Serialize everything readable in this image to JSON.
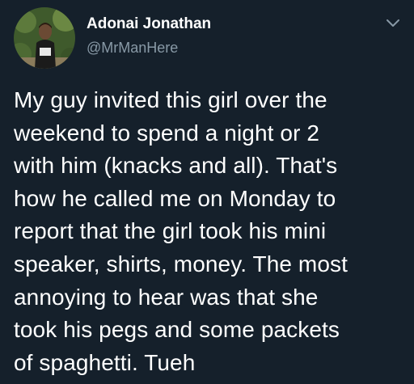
{
  "author": {
    "display_name": "Adonai Jonathan",
    "handle": "@MrManHere",
    "avatar_icon": "profile-photo-icon"
  },
  "menu": {
    "icon": "chevron-down-icon"
  },
  "tweet": {
    "lines": [
      "My guy invited this girl over the",
      "weekend to spend a night or 2",
      "with him (knacks and all). That's",
      "how he called me on Monday to",
      "report that the girl took his mini",
      "speaker, shirts, money. The most",
      "annoying to hear was that she",
      "took his pegs and some packets",
      "of spaghetti. Tueh"
    ]
  },
  "colors": {
    "background": "#15202b",
    "primary_text": "#ffffff",
    "secondary_text": "#8899a6"
  }
}
